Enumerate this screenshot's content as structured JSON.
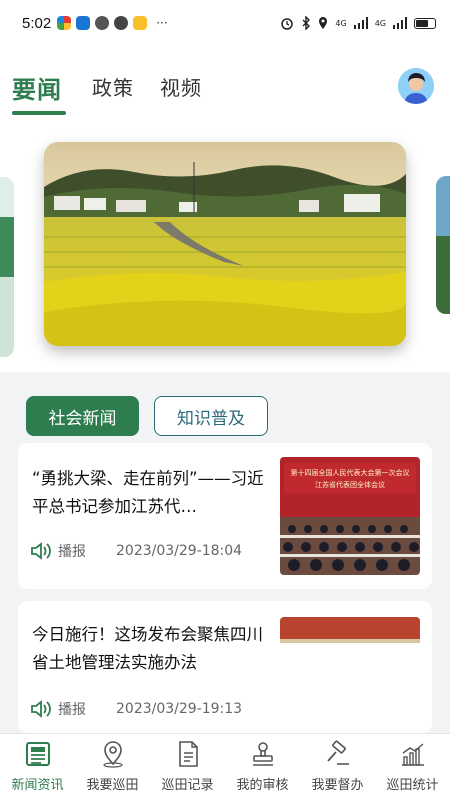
{
  "status_bar": {
    "time": "5:02",
    "dots": "···",
    "signal_1": "4G",
    "signal_2": "4G"
  },
  "top_tabs": [
    {
      "label": "要闻",
      "active": true
    },
    {
      "label": "政策",
      "active": false
    },
    {
      "label": "视频",
      "active": false
    }
  ],
  "categories": [
    {
      "label": "社会新闻",
      "active": true
    },
    {
      "label": "知识普及",
      "active": false
    }
  ],
  "news": [
    {
      "title": "“勇挑大梁、走在前列”——习近平总书记参加江苏代…",
      "play_label": "播报",
      "date": "2023/03/29-18:04",
      "thumb_caption": "第十四届全国人民代表大会第一次会议 江苏省代表团全体会议"
    },
    {
      "title": "今日施行！这场发布会聚焦四川省土地管理法实施办法",
      "play_label": "播报",
      "date": "2023/03/29-19:13"
    }
  ],
  "bottom_nav": [
    {
      "label": "新闻资讯",
      "icon": "news-icon",
      "active": true
    },
    {
      "label": "我要巡田",
      "icon": "location-pin-icon",
      "active": false
    },
    {
      "label": "巡田记录",
      "icon": "document-icon",
      "active": false
    },
    {
      "label": "我的审核",
      "icon": "stamp-icon",
      "active": false
    },
    {
      "label": "我要督办",
      "icon": "gavel-icon",
      "active": false
    },
    {
      "label": "巡田统计",
      "icon": "bar-chart-icon",
      "active": false
    }
  ],
  "colors": {
    "accent": "#2e7d4f",
    "outline": "#2e6b7a",
    "background": "#f2f3f5"
  }
}
